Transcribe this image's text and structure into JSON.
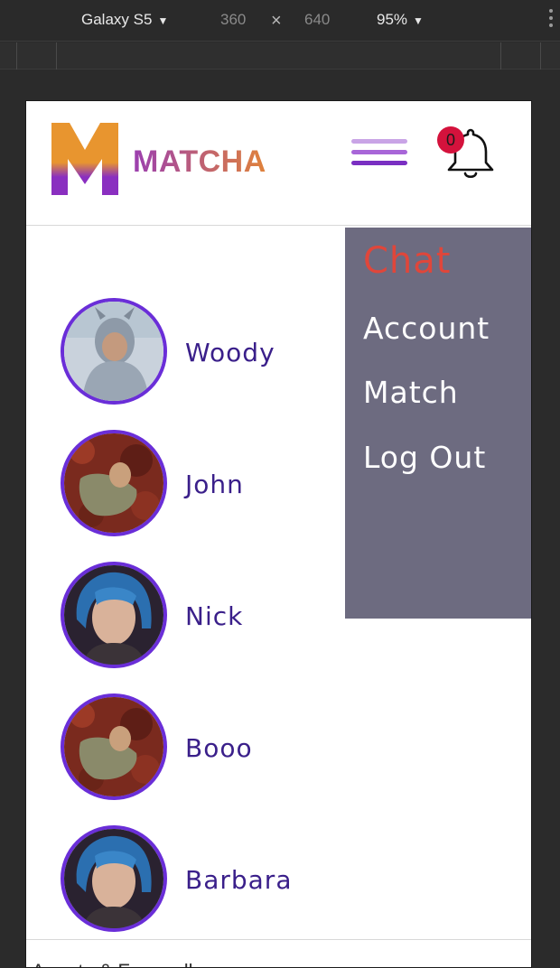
{
  "devtools": {
    "device": "Galaxy S5",
    "width": "360",
    "times": "×",
    "height": "640",
    "zoom": "95%"
  },
  "header": {
    "logo_letter": "M",
    "app_name": "MATCHA",
    "notification_count": "0"
  },
  "menu": {
    "items": [
      {
        "label": "Chat"
      },
      {
        "label": "Account"
      },
      {
        "label": "Match"
      },
      {
        "label": "Log Out"
      }
    ]
  },
  "chat_list": [
    {
      "name": "Woody"
    },
    {
      "name": "John"
    },
    {
      "name": "Nick"
    },
    {
      "name": "Booo"
    },
    {
      "name": "Barbara"
    }
  ],
  "footer": {
    "text": "Agents & Farewell"
  },
  "colors": {
    "menu_bg": "#6d6b80",
    "menu_active": "#e0463a",
    "avatar_border": "#6a2ed8",
    "name_text": "#3a1f8a",
    "badge": "#d4123c"
  }
}
